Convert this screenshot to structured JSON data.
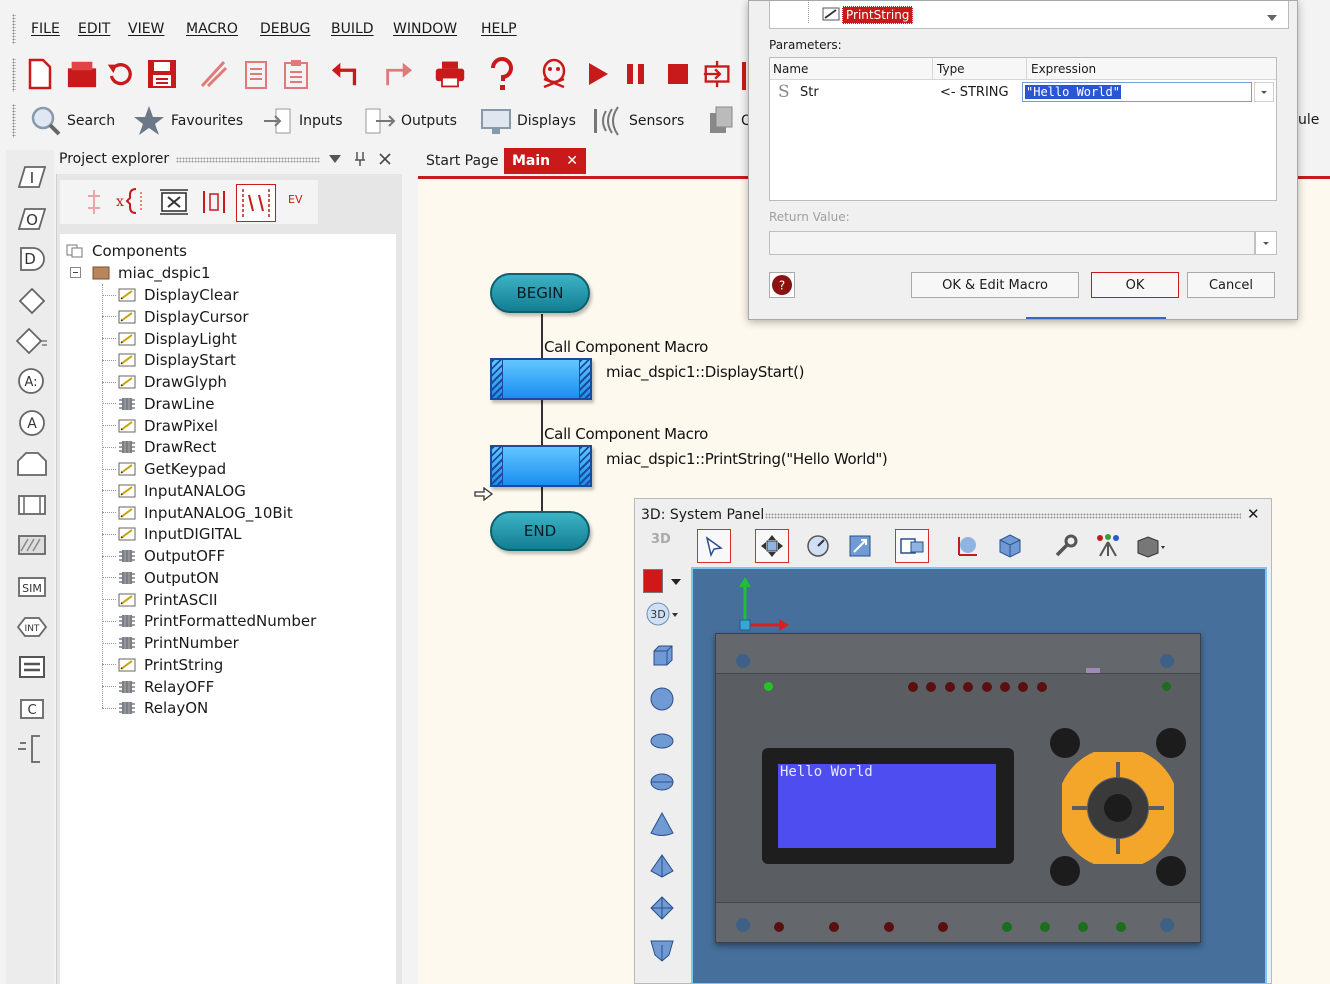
{
  "menu": {
    "items": [
      "FILE",
      "EDIT",
      "VIEW",
      "MACRO",
      "DEBUG",
      "BUILD",
      "WINDOW",
      "HELP"
    ]
  },
  "iconbar": {
    "search": "Search",
    "favourites": "Favourites",
    "inputs": "Inputs",
    "outputs": "Outputs",
    "displays": "Displays",
    "sensors": "Sensors",
    "partial_left": "C",
    "partial_right": "ule"
  },
  "left_tools": [
    "I",
    "O",
    "D",
    "A:",
    "A",
    "SIM",
    "INT",
    "C"
  ],
  "project_explorer": {
    "title": "Project explorer",
    "evt_label": "EV",
    "root": "Components",
    "component": "miac_dspic1",
    "macros": [
      {
        "name": "DisplayClear",
        "kind": "pencil"
      },
      {
        "name": "DisplayCursor",
        "kind": "pencil"
      },
      {
        "name": "DisplayLight",
        "kind": "pencil"
      },
      {
        "name": "DisplayStart",
        "kind": "pencil"
      },
      {
        "name": "DrawGlyph",
        "kind": "pencil"
      },
      {
        "name": "DrawLine",
        "kind": "chip"
      },
      {
        "name": "DrawPixel",
        "kind": "pencil"
      },
      {
        "name": "DrawRect",
        "kind": "chip"
      },
      {
        "name": "GetKeypad",
        "kind": "pencil"
      },
      {
        "name": "InputANALOG",
        "kind": "pencil"
      },
      {
        "name": "InputANALOG_10Bit",
        "kind": "pencil"
      },
      {
        "name": "InputDIGITAL",
        "kind": "pencil"
      },
      {
        "name": "OutputOFF",
        "kind": "chip"
      },
      {
        "name": "OutputON",
        "kind": "chip"
      },
      {
        "name": "PrintASCII",
        "kind": "pencil"
      },
      {
        "name": "PrintFormattedNumber",
        "kind": "chip"
      },
      {
        "name": "PrintNumber",
        "kind": "chip"
      },
      {
        "name": "PrintString",
        "kind": "pencil"
      },
      {
        "name": "RelayOFF",
        "kind": "chip"
      },
      {
        "name": "RelayON",
        "kind": "chip"
      }
    ]
  },
  "tabs": {
    "start": "Start Page",
    "main": "Main",
    "close": "✕"
  },
  "flowchart": {
    "begin": "BEGIN",
    "end": "END",
    "call1_title": "Call Component Macro",
    "call1_text": "miac_dspic1::DisplayStart()",
    "call2_title": "Call Component Macro",
    "call2_text": "miac_dspic1::PrintString(\"Hello World\")"
  },
  "dialog": {
    "selected_macro": "PrintString",
    "parameters_label": "Parameters:",
    "col_name": "Name",
    "col_type": "Type",
    "col_expression": "Expression",
    "param_icon": "S",
    "param_name": "Str",
    "param_type": "<- STRING",
    "param_expression": "\"Hello World\"",
    "return_label": "Return Value:",
    "return_value": "",
    "btn_ok_edit": "OK & Edit Macro",
    "btn_ok": "OK",
    "btn_cancel": "Cancel",
    "help_glyph": "?"
  },
  "system_panel": {
    "title": "3D: System Panel",
    "mode": "3D",
    "side_mode": "3D",
    "close": "✕",
    "lcd_text": "Hello World"
  },
  "colors": {
    "accent_red": "#c81a1a",
    "canvas_bg": "#fdf9ee",
    "viewport_bg": "#466f9b",
    "lcd_bg": "#4e4ef0",
    "keypad_ring": "#f4a62a"
  }
}
